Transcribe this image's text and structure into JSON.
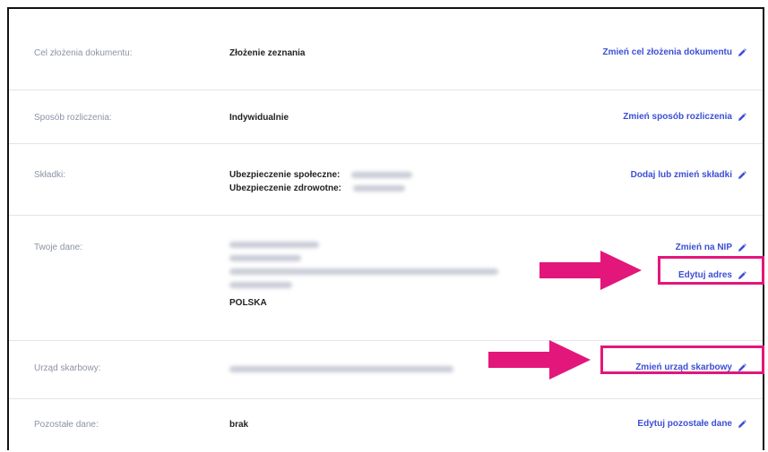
{
  "colors": {
    "link": "#3b4fd6",
    "label": "#8d93a6",
    "highlight": "#e3167c",
    "divider": "#e2e4ec"
  },
  "rows": [
    {
      "label": "Cel złożenia dokumentu:",
      "value": "Złożenie zeznania",
      "action": "Zmień cel złożenia dokumentu",
      "action_icon": "pencil-icon"
    },
    {
      "label": "Sposób rozliczenia:",
      "value": "Indywidualnie",
      "action": "Zmień sposób rozliczenia",
      "action_icon": "pencil-icon"
    },
    {
      "label": "Składki:",
      "value_lines": [
        "Ubezpieczenie społeczne:",
        "Ubezpieczenie zdrowotne:"
      ],
      "action": "Dodaj lub zmień składki",
      "action_icon": "pencil-icon"
    },
    {
      "label": "Twoje dane:",
      "value_last": "POLSKA",
      "actions": [
        "Zmień na NIP",
        "Edytuj adres"
      ],
      "action_icon": "pencil-icon"
    },
    {
      "label": "Urząd skarbowy:",
      "action": "Zmień urząd skarbowy",
      "action_icon": "pencil-icon"
    },
    {
      "label": "Pozostałe dane:",
      "value": "brak",
      "action": "Edytuj pozostałe dane",
      "action_icon": "pencil-icon"
    }
  ]
}
